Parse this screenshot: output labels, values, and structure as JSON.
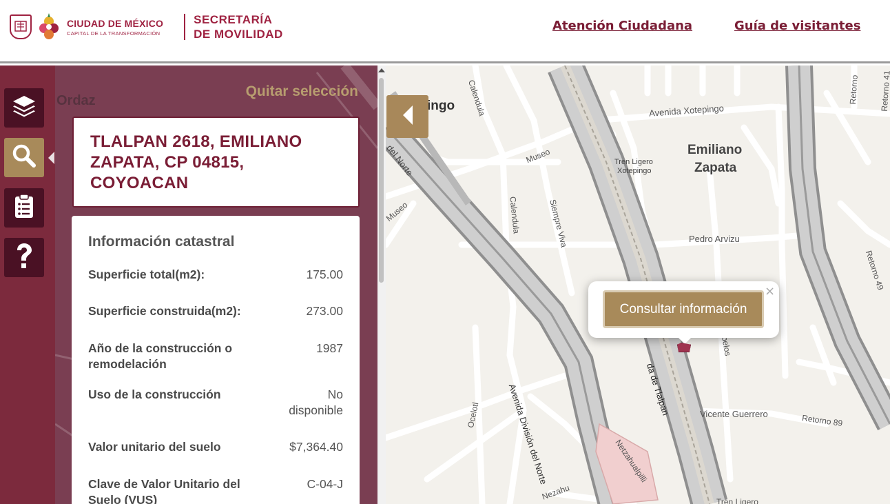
{
  "header": {
    "cdmx_title": "CIUDAD DE MÉXICO",
    "cdmx_subtitle": "CAPITAL DE LA TRANSFORMACIÓN",
    "secretaria_line1": "SECRETARÍA",
    "secretaria_line2": "DE MOVILIDAD",
    "nav": [
      "Atención Ciudadana",
      "Guía de visitantes"
    ]
  },
  "sidebar": {
    "items": [
      {
        "name": "layers",
        "icon": "layers-icon"
      },
      {
        "name": "search",
        "icon": "search-icon",
        "active": true
      },
      {
        "name": "report",
        "icon": "clipboard-icon"
      },
      {
        "name": "help",
        "icon": "question-icon"
      }
    ]
  },
  "panel": {
    "clear_selection": "Quitar selección",
    "address_lines": [
      "TLALPAN 2618, EMILIANO",
      "ZAPATA, CP 04815,",
      "COYOACAN"
    ],
    "info_title": "Información catastral",
    "rows": [
      {
        "label": "Superficie total(m2):",
        "value": "175.00"
      },
      {
        "label": "Superficie construida(m2):",
        "value": "273.00"
      },
      {
        "label": "Año de la construcción o remodelación",
        "value": "1987"
      },
      {
        "label": "Uso de la construcción",
        "value": "No disponible"
      },
      {
        "label": "Valor unitario del suelo",
        "value": "$7,364.40"
      },
      {
        "label": "Clave de Valor Unitario del Suelo (VUS)",
        "value": "C-04-J"
      }
    ]
  },
  "map": {
    "popup_button": "Consultar información",
    "popup_close": "×",
    "labels": {
      "ordaz": "Ordaz",
      "xotepingo_partial": "ingo",
      "avenida_xotepingo": "Avenida Xotepingo",
      "calendula_top": "Calendula",
      "calendula_mid": "Calendula",
      "museo_top": "Museo",
      "museo_left": "Museo",
      "del_norte_top": "del Norte",
      "tren_ligero": "Tren Ligero",
      "xotepingo_station": "Xotepingo",
      "emiliano": "Emiliano",
      "zapata": "Zapata",
      "siempre_viva": "Siempre Viva",
      "pedro_arvizu": "Pedro Arvizu",
      "retorno_49": "Retorno 49",
      "retorno_41": "Retorno 41",
      "retorno_top": "Retorno",
      "avenida_division": "Avenida División del Norte",
      "calzada_tlalpan": "da de Tlalpan",
      "ebelos": "belos",
      "vicente_guerrero": "Vicente Guerrero",
      "retorno_89": "Retorno 89",
      "ocelotl": "Ocelotl",
      "netzahualpilli": "Netzahualpilli",
      "nezahu": "Nezahu",
      "tren_ligero_bottom": "Tren Ligero"
    }
  },
  "colors": {
    "brand": "#9f2241",
    "sidebar": "#7c2a3d",
    "gold": "#a88a5a"
  }
}
